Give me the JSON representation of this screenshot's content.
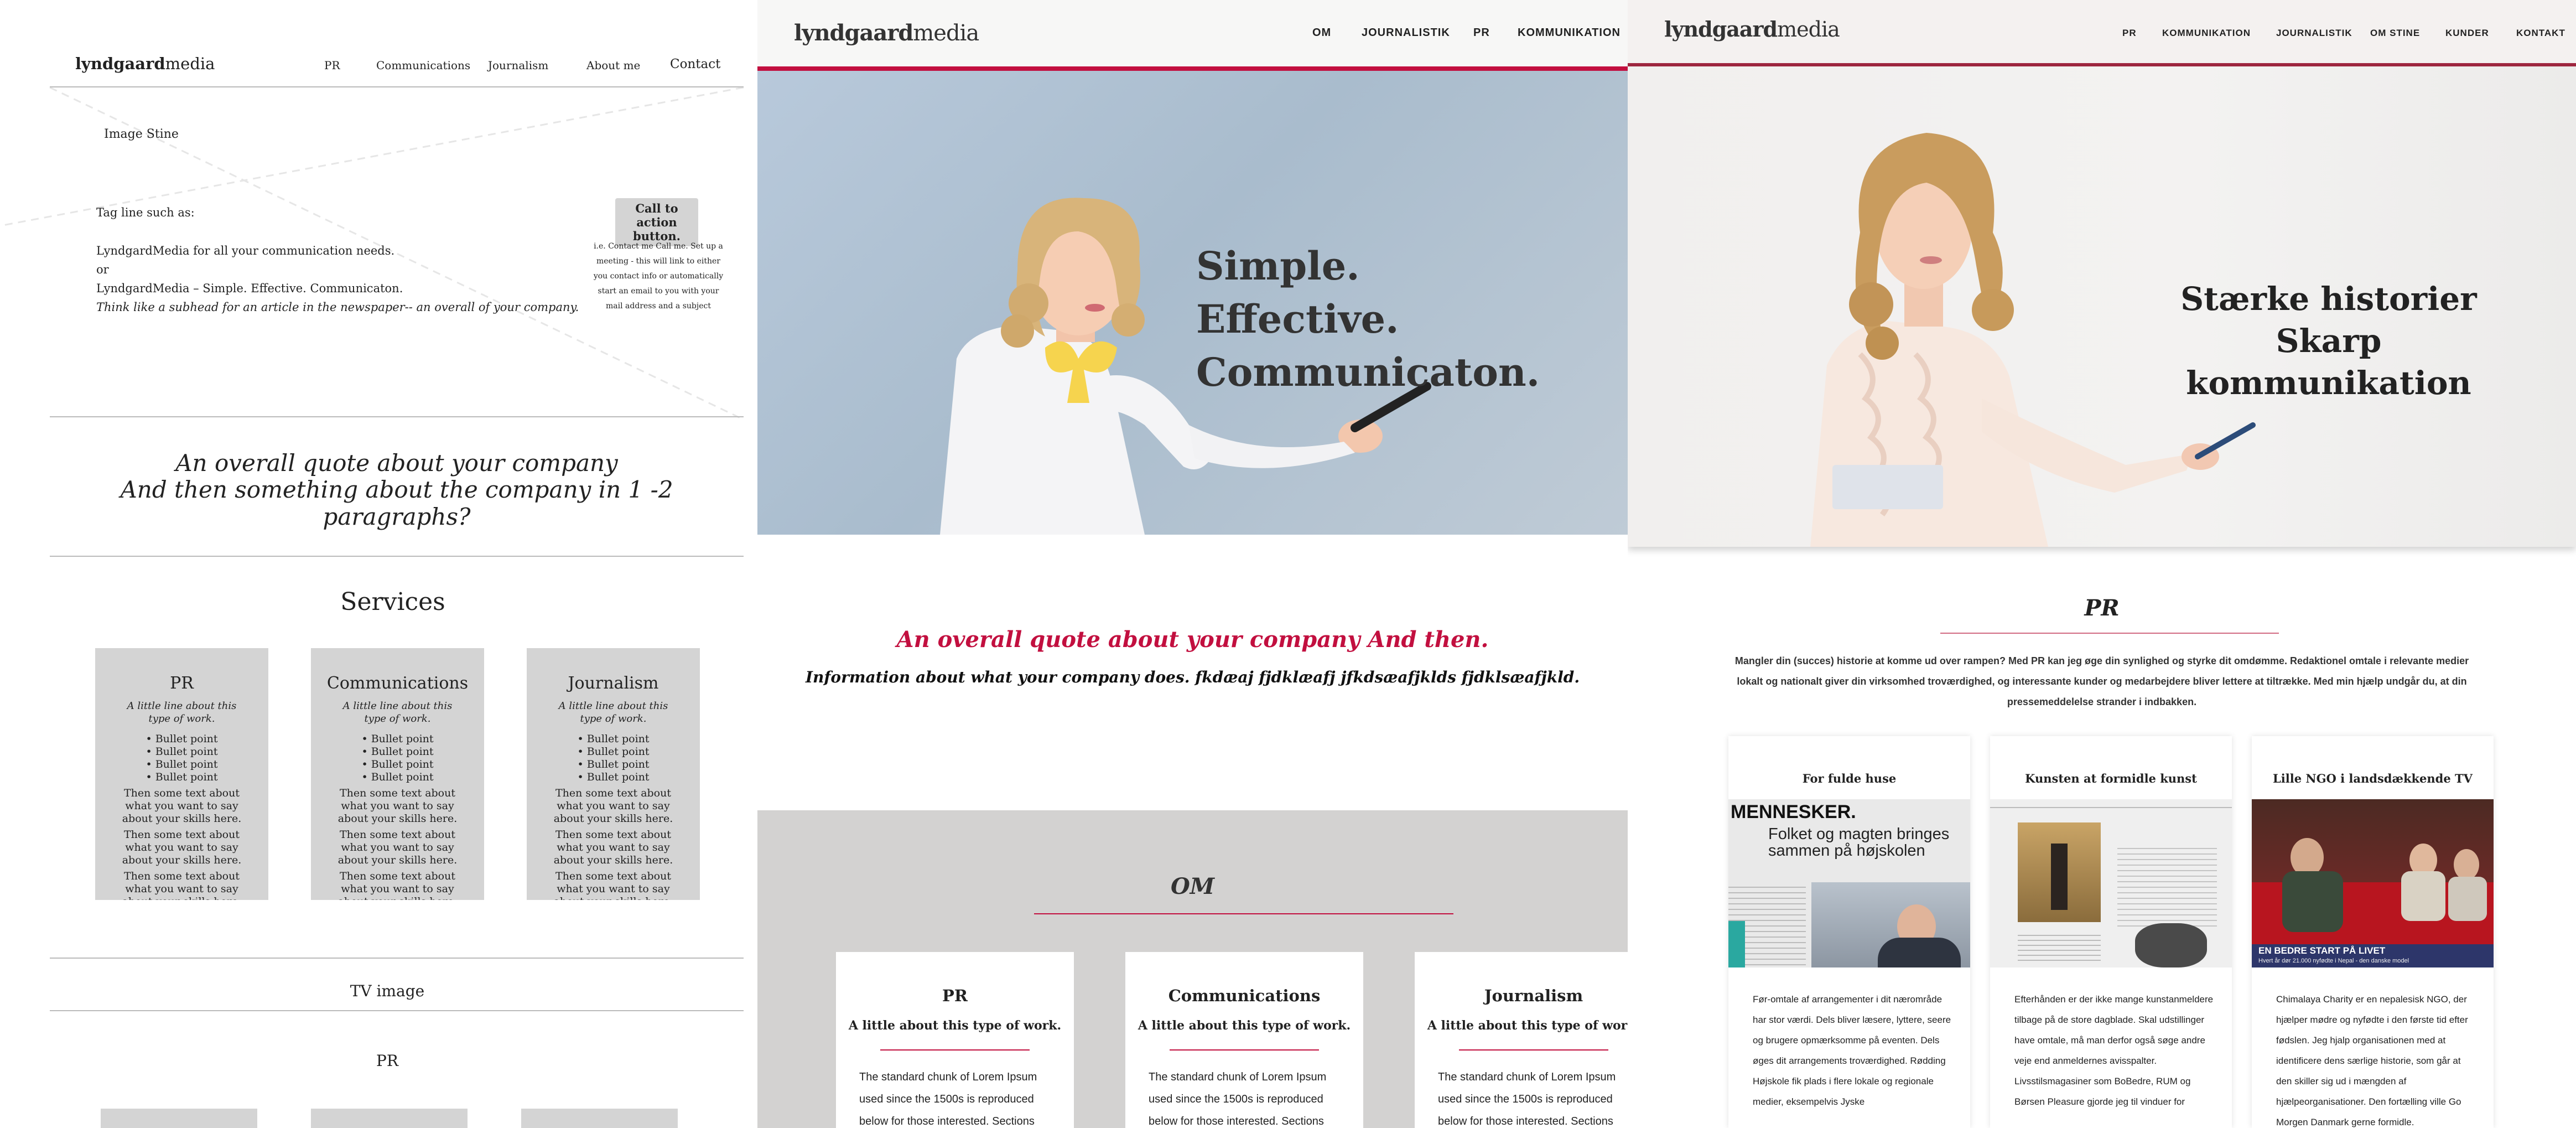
{
  "wireframe": {
    "logo_bold": "lyndgaard",
    "logo_rest": "media",
    "nav": [
      "PR",
      "Communications",
      "Journalism",
      "About me",
      "Contact"
    ],
    "image_label": "Image Stine",
    "tagline_lead": "Tag line such as:",
    "tagline_1": "LyndgardMedia for all your communication needs.",
    "tagline_or": "or",
    "tagline_2": "LyndgardMedia – Simple. Effective. Communicaton.",
    "tagline_sub": "Think like a subhead for an article in the newspaper-- an overall of your company.",
    "cta_label": "Call to action button.",
    "cta_note": "i.e. Contact me Call me. Set up a meeting - this will link to either you contact info or automatically start an email to you with your mail address and a subject",
    "quote_1": "An overall quote about your company",
    "quote_2": "And then something about the company in 1 -2 paragraphs?",
    "services_title": "Services",
    "boxes": [
      {
        "title": "PR",
        "sub": "A little line about this type of work.",
        "bullets": [
          "• Bullet point",
          "• Bullet point",
          "• Bullet point",
          "• Bullet point"
        ],
        "text": "Then some text about what you want to say about your skills here."
      },
      {
        "title": "Communications",
        "sub": "A little line about this type of work.",
        "bullets": [
          "• Bullet point",
          "• Bullet point",
          "• Bullet point",
          "• Bullet point"
        ],
        "text": "Then some text about what you want to say about your skills here."
      },
      {
        "title": "Journalism",
        "sub": "A little line about this type of work.",
        "bullets": [
          "• Bullet point",
          "• Bullet point",
          "• Bullet point",
          "• Bullet point"
        ],
        "text": "Then some text about what you want to say about your skills here."
      }
    ],
    "tv_label": "TV image",
    "pr_label": "PR"
  },
  "design1": {
    "logo_bold": "lyndgaard",
    "logo_rest": "media",
    "nav": [
      "OM",
      "JOURNALISTIK",
      "PR",
      "KOMMUNIKATION"
    ],
    "hero_lines": [
      "Simple.",
      "Effective.",
      "Communicaton."
    ],
    "quote": "An overall quote about your company And then.",
    "info": "Information about what your company does. fkdæaj fjdklæafj jfkdsæafjklds fjdklsæafjkld.",
    "om_title": "OM",
    "cards": [
      {
        "title": "PR",
        "sub": "A little about this type of work.",
        "body": "The standard chunk of Lorem Ipsum used since the 1500s is reproduced below for those interested. Sections"
      },
      {
        "title": "Communications",
        "sub": "A little about this type of work.",
        "body": "The standard chunk of Lorem Ipsum used since the 1500s is reproduced below for those interested. Sections"
      },
      {
        "title": "Journalism",
        "sub": "A little about this type of work.",
        "body": "The standard chunk of Lorem Ipsum used since the 1500s is reproduced below for those interested. Sections"
      }
    ],
    "accent": "#c20f3f"
  },
  "design2": {
    "logo_bold": "lyndgaard",
    "logo_rest": "media",
    "nav": [
      "PR",
      "KOMMUNIKATION",
      "JOURNALISTIK",
      "OM STINE",
      "KUNDER",
      "KONTAKT"
    ],
    "hero_1": "Stærke historier",
    "hero_2": "Skarp kommunikation",
    "pr_title": "PR",
    "intro": "Mangler din (succes) historie at komme ud over rampen? Med PR kan jeg øge din synlighed og styrke dit omdømme. Redaktionel omtale i relevante medier lokalt og nationalt giver din virksomhed troværdighed, og interessante kunder og medarbejdere bliver lettere at tiltrække. Med min hjælp undgår du, at din pressemeddelelse strander i indbakken.",
    "cards": [
      {
        "title": "For fulde huse",
        "headline": "MENNESKER.",
        "subhead": "Folket og magten bringes sammen på højskolen",
        "body": "Før-omtale af arrangementer i dit nærområde har stor værdi. Dels bliver læsere, lyttere, seere og brugere opmærksomme på eventen. Dels øges dit arrangements troværdighed. Rødding Højskole fik plads i flere lokale og regionale medier, eksempelvis Jyske"
      },
      {
        "title": "Kunsten at formidle kunst",
        "body": "Efterhånden er der ikke mange kunstanmeldere tilbage på de store dagblade. Skal udstillinger have omtale, må man derfor også søge andre veje end anmeldernes avisspalter. Livsstilsmagasiner som BoBedre, RUM og Børsen Pleasure gjorde jeg til vinduer for"
      },
      {
        "title": "Lille NGO i landsdækkende TV",
        "caption": "EN BEDRE START PÅ LIVET",
        "caption_sub": "Hvert år dør 21.000 nyfødte i Nepal - den danske model",
        "body": "Chimalaya Charity er en nepalesisk NGO, der hjælper mødre og nyfødte i den første tid efter fødslen. Jeg hjalp organisationen med at identificere dens særlige historie, som går at den skiller sig ud i mængden af hjælpeorganisationer. Den fortælling ville Go Morgen Danmark gerne formidle."
      }
    ],
    "accent": "#a02740"
  }
}
